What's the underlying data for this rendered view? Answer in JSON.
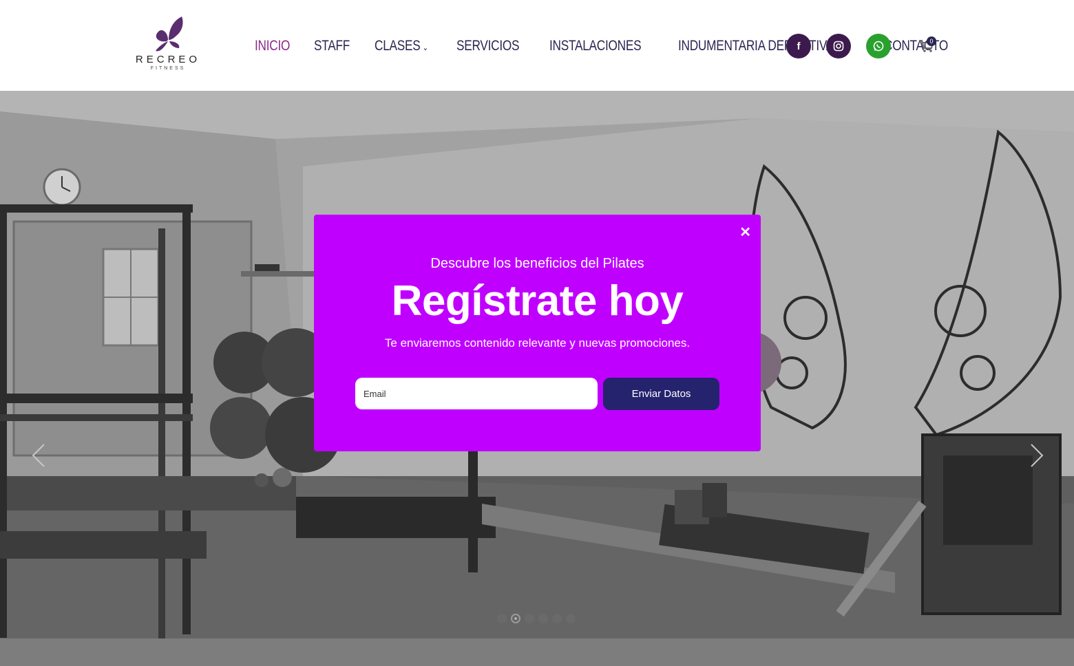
{
  "brand": {
    "name": "RECREO",
    "tagline": "FITNESS",
    "color": "#5a2d6e"
  },
  "nav": {
    "items": [
      {
        "label": "INICIO",
        "active": true
      },
      {
        "label": "STAFF"
      },
      {
        "label": "CLASES",
        "has_dropdown": true
      },
      {
        "label": "SERVICIOS"
      },
      {
        "label": "INSTALACIONES"
      },
      {
        "label": "INDUMENTARIA DEPORTIVA"
      },
      {
        "label": "CONTACTO"
      }
    ],
    "dropdown_caret": "⌄"
  },
  "social": [
    {
      "icon": "facebook-icon",
      "glyph": "f",
      "color": "#3d1a4d"
    },
    {
      "icon": "instagram-icon",
      "glyph": "◎",
      "color": "#3d1a4d"
    },
    {
      "icon": "whatsapp-icon",
      "glyph": "✆",
      "color": "#2aa12e"
    }
  ],
  "cart": {
    "icon": "cart-icon",
    "count": "0"
  },
  "slider": {
    "slides": 6,
    "active_index": 1
  },
  "modal": {
    "close_glyph": "✕",
    "kicker": "Descubre los beneficios del Pilates",
    "title": "Regístrate hoy",
    "subtitle": "Te enviaremos contenido relevante y nuevas promociones.",
    "email_placeholder": "Email",
    "email_value": "",
    "submit_label": "Enviar Datos",
    "background": "#c000ff",
    "button_color": "#25226e"
  }
}
